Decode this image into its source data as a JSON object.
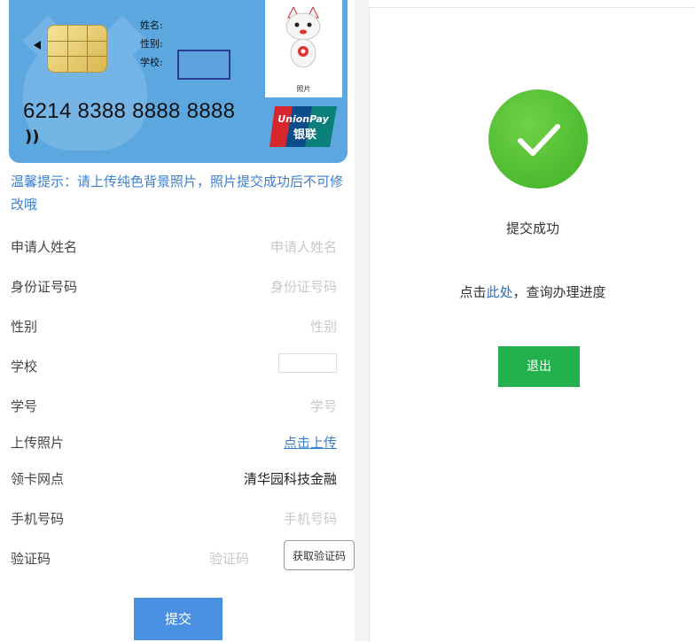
{
  "card": {
    "name_label": "姓名:",
    "gender_label": "性别:",
    "school_label": "学校:",
    "number": "6214 8388 8888 8888",
    "photo_caption": "照片",
    "unionpay_top": "UnionPay",
    "unionpay_bottom": "银联",
    "nfc_symbol": "))"
  },
  "tip": "温馨提示：请上传纯色背景照片，照片提交成功后不可修改哦",
  "form": {
    "applicant_name": {
      "label": "申请人姓名",
      "placeholder": "申请人姓名"
    },
    "id_number": {
      "label": "身份证号码",
      "placeholder": "身份证号码"
    },
    "gender": {
      "label": "性别",
      "placeholder": "性别"
    },
    "school": {
      "label": "学校"
    },
    "student_id": {
      "label": "学号",
      "placeholder": "学号"
    },
    "upload_photo": {
      "label": "上传照片",
      "action": "点击上传"
    },
    "pickup_branch": {
      "label": "领卡网点",
      "value": "清华园科技金融"
    },
    "phone": {
      "label": "手机号码",
      "placeholder": "手机号码"
    },
    "verify_code": {
      "label": "验证码",
      "placeholder": "验证码",
      "button": "获取验证码"
    },
    "submit_label": "提交"
  },
  "success": {
    "title": "提交成功",
    "query_prefix": "点击",
    "query_link": "此处",
    "query_suffix": "，查询办理进度",
    "exit_label": "退出"
  },
  "colors": {
    "card_blue": "#5da7e0",
    "link_blue": "#3b7fd0",
    "submit_blue": "#4a90e2",
    "success_green": "#3fb126",
    "exit_green": "#22b14c"
  }
}
